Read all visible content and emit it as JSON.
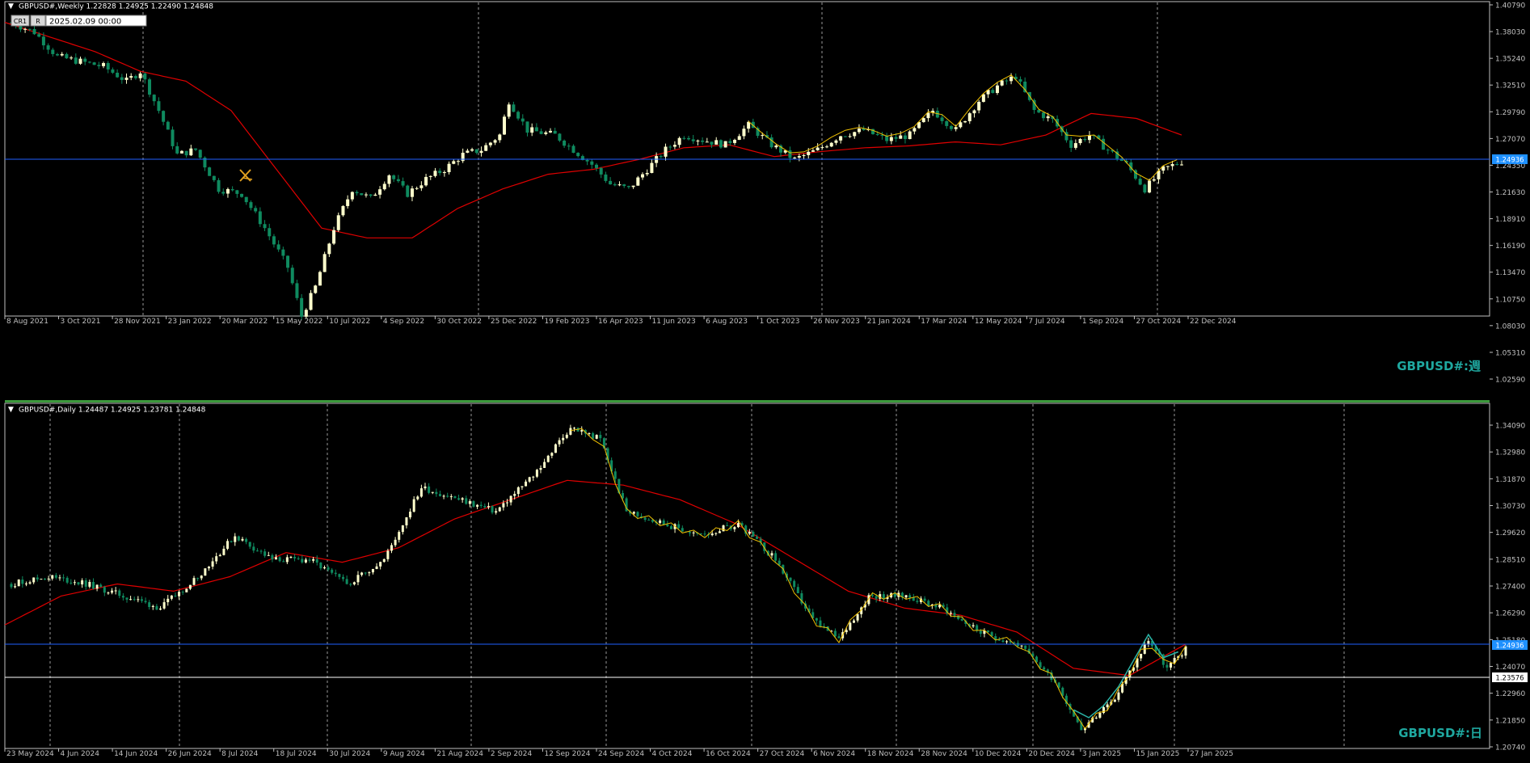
{
  "colors": {
    "background": "#000000",
    "frame": "#c0c0c0",
    "grid": "#c0c0c0",
    "bull_candle": "#ffffcc",
    "bear_candle": "#0f8a5f",
    "ma_line": "#e00000",
    "zigzag_line": "#f0c000",
    "zigzag_line_2": "#2ab3a6",
    "hline_blue": "#2060ff",
    "hline_white": "#ffffff",
    "price_tag_blue": "#1e90ff",
    "symbol_label": "#1fa8a0",
    "separator": "#3c9a3c",
    "axis_text": "#c0c0c0"
  },
  "toolbar": {
    "buttons": [
      "CR1",
      "R"
    ],
    "date_box": "2025.02.09 00:00"
  },
  "charts": [
    {
      "id": "weekly",
      "header": "GBPUSD#,Weekly  1.22828 1.24925 1.22490 1.24848",
      "symbol_label": "GBPUSD#:週",
      "y_ticks": [
        "1.40790",
        "1.38030",
        "1.35240",
        "1.32510",
        "1.29790",
        "1.27070",
        "1.24350",
        "1.21630",
        "1.18910",
        "1.16190",
        "1.13470",
        "1.10750",
        "1.08030",
        "1.05310",
        "1.02590"
      ],
      "x_ticks": [
        "8 Aug 2021",
        "3 Oct 2021",
        "28 Nov 2021",
        "23 Jan 2022",
        "20 Mar 2022",
        "15 May 2022",
        "10 Jul 2022",
        "4 Sep 2022",
        "30 Oct 2022",
        "25 Dec 2022",
        "19 Feb 2023",
        "16 Apr 2023",
        "11 Jun 2023",
        "6 Aug 2023",
        "1 Oct 2023",
        "26 Nov 2023",
        "21 Jan 2024",
        "17 Mar 2024",
        "12 May 2024",
        "7 Jul 2024",
        "1 Sep 2024",
        "27 Oct 2024",
        "22 Dec 2024"
      ],
      "current_price_label": "1.24936",
      "overlapping_tick_label": "1.24350"
    },
    {
      "id": "daily",
      "header": "GBPUSD#,Daily  1.24487 1.24925 1.23781 1.24848",
      "symbol_label": "GBPUSD#:日",
      "y_ticks": [
        "1.34090",
        "1.32980",
        "1.31870",
        "1.30730",
        "1.29620",
        "1.28510",
        "1.27400",
        "1.26290",
        "1.25180",
        "1.24070",
        "1.22960",
        "1.21850",
        "1.20740"
      ],
      "x_ticks": [
        "23 May 2024",
        "4 Jun 2024",
        "14 Jun 2024",
        "26 Jun 2024",
        "8 Jul 2024",
        "18 Jul 2024",
        "30 Jul 2024",
        "9 Aug 2024",
        "21 Aug 2024",
        "2 Sep 2024",
        "12 Sep 2024",
        "24 Sep 2024",
        "4 Oct 2024",
        "16 Oct 2024",
        "27 Oct 2024",
        "6 Nov 2024",
        "18 Nov 2024",
        "28 Nov 2024",
        "10 Dec 2024",
        "20 Dec 2024",
        "3 Jan 2025",
        "15 Jan 2025",
        "27 Jan 2025"
      ],
      "current_price_label": "1.24936",
      "second_line_label": "1.23576",
      "overlapping_tick_label": "1.25180"
    }
  ],
  "chart_data": [
    {
      "type": "candlestick",
      "title": "GBPUSD#,Weekly",
      "ylim": [
        1.0259,
        1.4079
      ],
      "current_price": 1.24936,
      "moving_average_path": [
        [
          0,
          1.39
        ],
        [
          10,
          1.375
        ],
        [
          20,
          1.36
        ],
        [
          30,
          1.34
        ],
        [
          40,
          1.33
        ],
        [
          50,
          1.3
        ],
        [
          60,
          1.24
        ],
        [
          70,
          1.18
        ],
        [
          80,
          1.17
        ],
        [
          90,
          1.17
        ],
        [
          100,
          1.2
        ],
        [
          110,
          1.22
        ],
        [
          120,
          1.235
        ],
        [
          130,
          1.24
        ],
        [
          140,
          1.25
        ],
        [
          150,
          1.262
        ],
        [
          160,
          1.265
        ],
        [
          170,
          1.253
        ],
        [
          180,
          1.258
        ],
        [
          190,
          1.262
        ],
        [
          200,
          1.264
        ],
        [
          210,
          1.268
        ],
        [
          220,
          1.265
        ],
        [
          230,
          1.275
        ],
        [
          240,
          1.297
        ],
        [
          250,
          1.292
        ],
        [
          260,
          1.275
        ]
      ],
      "close_path": [
        [
          0,
          1.39
        ],
        [
          5,
          1.38
        ],
        [
          10,
          1.355
        ],
        [
          15,
          1.35
        ],
        [
          20,
          1.345
        ],
        [
          25,
          1.33
        ],
        [
          28,
          1.34
        ],
        [
          32,
          1.3
        ],
        [
          36,
          1.255
        ],
        [
          40,
          1.26
        ],
        [
          45,
          1.22
        ],
        [
          50,
          1.215
        ],
        [
          55,
          1.18
        ],
        [
          60,
          1.14
        ],
        [
          63,
          1.09
        ],
        [
          66,
          1.12
        ],
        [
          70,
          1.18
        ],
        [
          74,
          1.22
        ],
        [
          78,
          1.21
        ],
        [
          82,
          1.235
        ],
        [
          86,
          1.215
        ],
        [
          90,
          1.23
        ],
        [
          94,
          1.24
        ],
        [
          98,
          1.255
        ],
        [
          102,
          1.26
        ],
        [
          106,
          1.275
        ],
        [
          108,
          1.31
        ],
        [
          112,
          1.28
        ],
        [
          118,
          1.275
        ],
        [
          122,
          1.26
        ],
        [
          126,
          1.245
        ],
        [
          130,
          1.225
        ],
        [
          134,
          1.22
        ],
        [
          138,
          1.24
        ],
        [
          142,
          1.26
        ],
        [
          146,
          1.275
        ],
        [
          150,
          1.27
        ],
        [
          155,
          1.265
        ],
        [
          160,
          1.285
        ],
        [
          165,
          1.265
        ],
        [
          170,
          1.25
        ],
        [
          175,
          1.26
        ],
        [
          180,
          1.275
        ],
        [
          185,
          1.28
        ],
        [
          190,
          1.27
        ],
        [
          195,
          1.275
        ],
        [
          200,
          1.3
        ],
        [
          205,
          1.28
        ],
        [
          210,
          1.31
        ],
        [
          214,
          1.325
        ],
        [
          218,
          1.335
        ],
        [
          222,
          1.3
        ],
        [
          226,
          1.29
        ],
        [
          230,
          1.265
        ],
        [
          234,
          1.275
        ],
        [
          238,
          1.26
        ],
        [
          242,
          1.245
        ],
        [
          246,
          1.22
        ],
        [
          250,
          1.24
        ],
        [
          254,
          1.248
        ]
      ]
    },
    {
      "type": "candlestick",
      "title": "GBPUSD#,Daily",
      "ylim": [
        1.2074,
        1.3409
      ],
      "current_price": 1.24936,
      "second_line_price": 1.23576,
      "moving_average_path": [
        [
          0,
          1.258
        ],
        [
          15,
          1.27
        ],
        [
          30,
          1.275
        ],
        [
          45,
          1.272
        ],
        [
          60,
          1.278
        ],
        [
          75,
          1.288
        ],
        [
          90,
          1.284
        ],
        [
          105,
          1.29
        ],
        [
          120,
          1.302
        ],
        [
          135,
          1.31
        ],
        [
          150,
          1.318
        ],
        [
          165,
          1.316
        ],
        [
          180,
          1.31
        ],
        [
          195,
          1.3
        ],
        [
          210,
          1.286
        ],
        [
          225,
          1.272
        ],
        [
          240,
          1.265
        ],
        [
          255,
          1.262
        ],
        [
          270,
          1.255
        ],
        [
          285,
          1.24
        ],
        [
          300,
          1.237
        ],
        [
          315,
          1.25
        ]
      ],
      "close_path": [
        [
          0,
          1.275
        ],
        [
          10,
          1.278
        ],
        [
          20,
          1.275
        ],
        [
          30,
          1.27
        ],
        [
          40,
          1.265
        ],
        [
          50,
          1.278
        ],
        [
          60,
          1.295
        ],
        [
          70,
          1.285
        ],
        [
          80,
          1.285
        ],
        [
          90,
          1.275
        ],
        [
          100,
          1.285
        ],
        [
          110,
          1.315
        ],
        [
          120,
          1.31
        ],
        [
          130,
          1.305
        ],
        [
          140,
          1.32
        ],
        [
          150,
          1.34
        ],
        [
          158,
          1.335
        ],
        [
          165,
          1.305
        ],
        [
          175,
          1.3
        ],
        [
          185,
          1.295
        ],
        [
          195,
          1.3
        ],
        [
          205,
          1.285
        ],
        [
          215,
          1.26
        ],
        [
          222,
          1.252
        ],
        [
          230,
          1.27
        ],
        [
          240,
          1.27
        ],
        [
          250,
          1.265
        ],
        [
          260,
          1.255
        ],
        [
          270,
          1.25
        ],
        [
          280,
          1.235
        ],
        [
          287,
          1.215
        ],
        [
          295,
          1.225
        ],
        [
          305,
          1.252
        ],
        [
          310,
          1.24
        ],
        [
          315,
          1.248
        ]
      ]
    }
  ]
}
